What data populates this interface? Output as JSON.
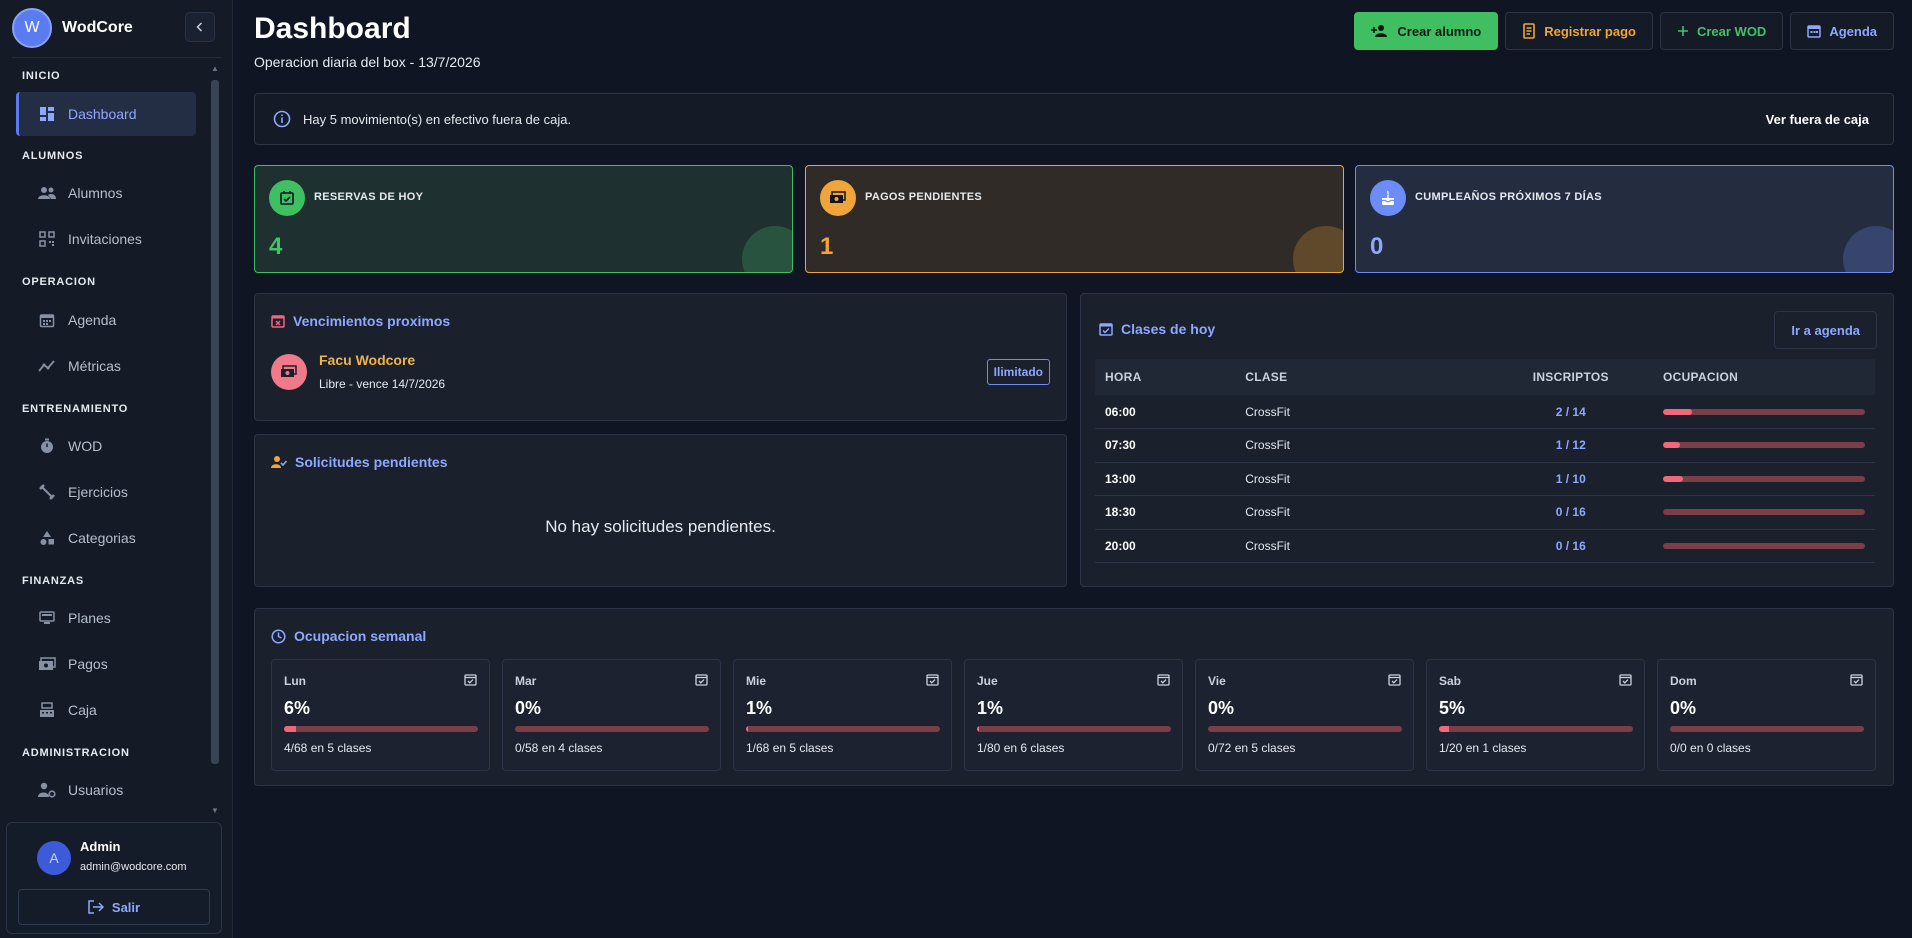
{
  "brand": {
    "initial": "W",
    "name": "WodCore"
  },
  "sidebar": {
    "sections": [
      {
        "title": "INICIO",
        "items": [
          {
            "label": "Dashboard",
            "icon": "dashboard-icon",
            "active": true
          }
        ]
      },
      {
        "title": "ALUMNOS",
        "items": [
          {
            "label": "Alumnos",
            "icon": "users-icon"
          },
          {
            "label": "Invitaciones",
            "icon": "qr-code-icon"
          }
        ]
      },
      {
        "title": "OPERACION",
        "items": [
          {
            "label": "Agenda",
            "icon": "calendar-icon"
          },
          {
            "label": "Métricas",
            "icon": "chart-icon"
          }
        ]
      },
      {
        "title": "ENTRENAMIENTO",
        "items": [
          {
            "label": "WOD",
            "icon": "timer-icon"
          },
          {
            "label": "Ejercicios",
            "icon": "dumbbell-icon"
          },
          {
            "label": "Categorias",
            "icon": "shapes-icon"
          }
        ]
      },
      {
        "title": "FINANZAS",
        "items": [
          {
            "label": "Planes",
            "icon": "planes-icon"
          },
          {
            "label": "Pagos",
            "icon": "money-icon"
          },
          {
            "label": "Caja",
            "icon": "cash-register-icon"
          }
        ]
      },
      {
        "title": "ADMINISTRACION",
        "items": [
          {
            "label": "Usuarios",
            "icon": "user-settings-icon"
          }
        ]
      }
    ]
  },
  "user": {
    "initial": "A",
    "name": "Admin",
    "email": "admin@wodcore.com",
    "logout_label": "Salir"
  },
  "header": {
    "title": "Dashboard",
    "subtitle": "Operacion diaria del box - 13/7/2026",
    "actions": {
      "crear_alumno": "Crear alumno",
      "registrar_pago": "Registrar pago",
      "crear_wod": "Crear WOD",
      "agenda": "Agenda"
    }
  },
  "banner": {
    "text": "Hay 5 movimiento(s) en efectivo fuera de caja.",
    "link": "Ver fuera de caja"
  },
  "stats": {
    "reservas": {
      "label": "RESERVAS DE HOY",
      "value": "4"
    },
    "pagos": {
      "label": "PAGOS PENDIENTES",
      "value": "1"
    },
    "cumples": {
      "label": "CUMPLEAÑOS PRÓXIMOS 7 DÍAS",
      "value": "0"
    }
  },
  "vencimientos": {
    "title": "Vencimientos proximos",
    "name": "Facu Wodcore",
    "detail": "Libre - vence 14/7/2026",
    "badge": "Ilimitado"
  },
  "solicitudes": {
    "title": "Solicitudes pendientes",
    "empty": "No hay solicitudes pendientes."
  },
  "clases": {
    "title": "Clases de hoy",
    "button": "Ir a agenda",
    "headers": {
      "hora": "HORA",
      "clase": "CLASE",
      "inscriptos": "INSCRIPTOS",
      "ocupacion": "OCUPACION"
    },
    "rows": [
      {
        "hora": "06:00",
        "clase": "CrossFit",
        "inscriptos": "2 / 14",
        "occupancy": 0.143
      },
      {
        "hora": "07:30",
        "clase": "CrossFit",
        "inscriptos": "1 / 12",
        "occupancy": 0.083
      },
      {
        "hora": "13:00",
        "clase": "CrossFit",
        "inscriptos": "1 / 10",
        "occupancy": 0.1
      },
      {
        "hora": "18:30",
        "clase": "CrossFit",
        "inscriptos": "0 / 16",
        "occupancy": 0
      },
      {
        "hora": "20:00",
        "clase": "CrossFit",
        "inscriptos": "0 / 16",
        "occupancy": 0
      }
    ]
  },
  "semanal": {
    "title": "Ocupacion semanal",
    "days": [
      {
        "name": "Lun",
        "pct": "6%",
        "fraction": 0.06,
        "summary": "4/68 en 5 clases"
      },
      {
        "name": "Mar",
        "pct": "0%",
        "fraction": 0,
        "summary": "0/58 en 4 clases"
      },
      {
        "name": "Mie",
        "pct": "1%",
        "fraction": 0.01,
        "summary": "1/68 en 5 clases"
      },
      {
        "name": "Jue",
        "pct": "1%",
        "fraction": 0.01,
        "summary": "1/80 en 6 clases"
      },
      {
        "name": "Vie",
        "pct": "0%",
        "fraction": 0,
        "summary": "0/72 en 5 clases"
      },
      {
        "name": "Sab",
        "pct": "5%",
        "fraction": 0.05,
        "summary": "1/20 en 1 clases"
      },
      {
        "name": "Dom",
        "pct": "0%",
        "fraction": 0,
        "summary": "0/0 en 0 clases"
      }
    ]
  },
  "colors": {
    "accent": "#8ea8ff",
    "green": "#3fbf62",
    "orange": "#f0a53a",
    "red": "#f0687a"
  }
}
